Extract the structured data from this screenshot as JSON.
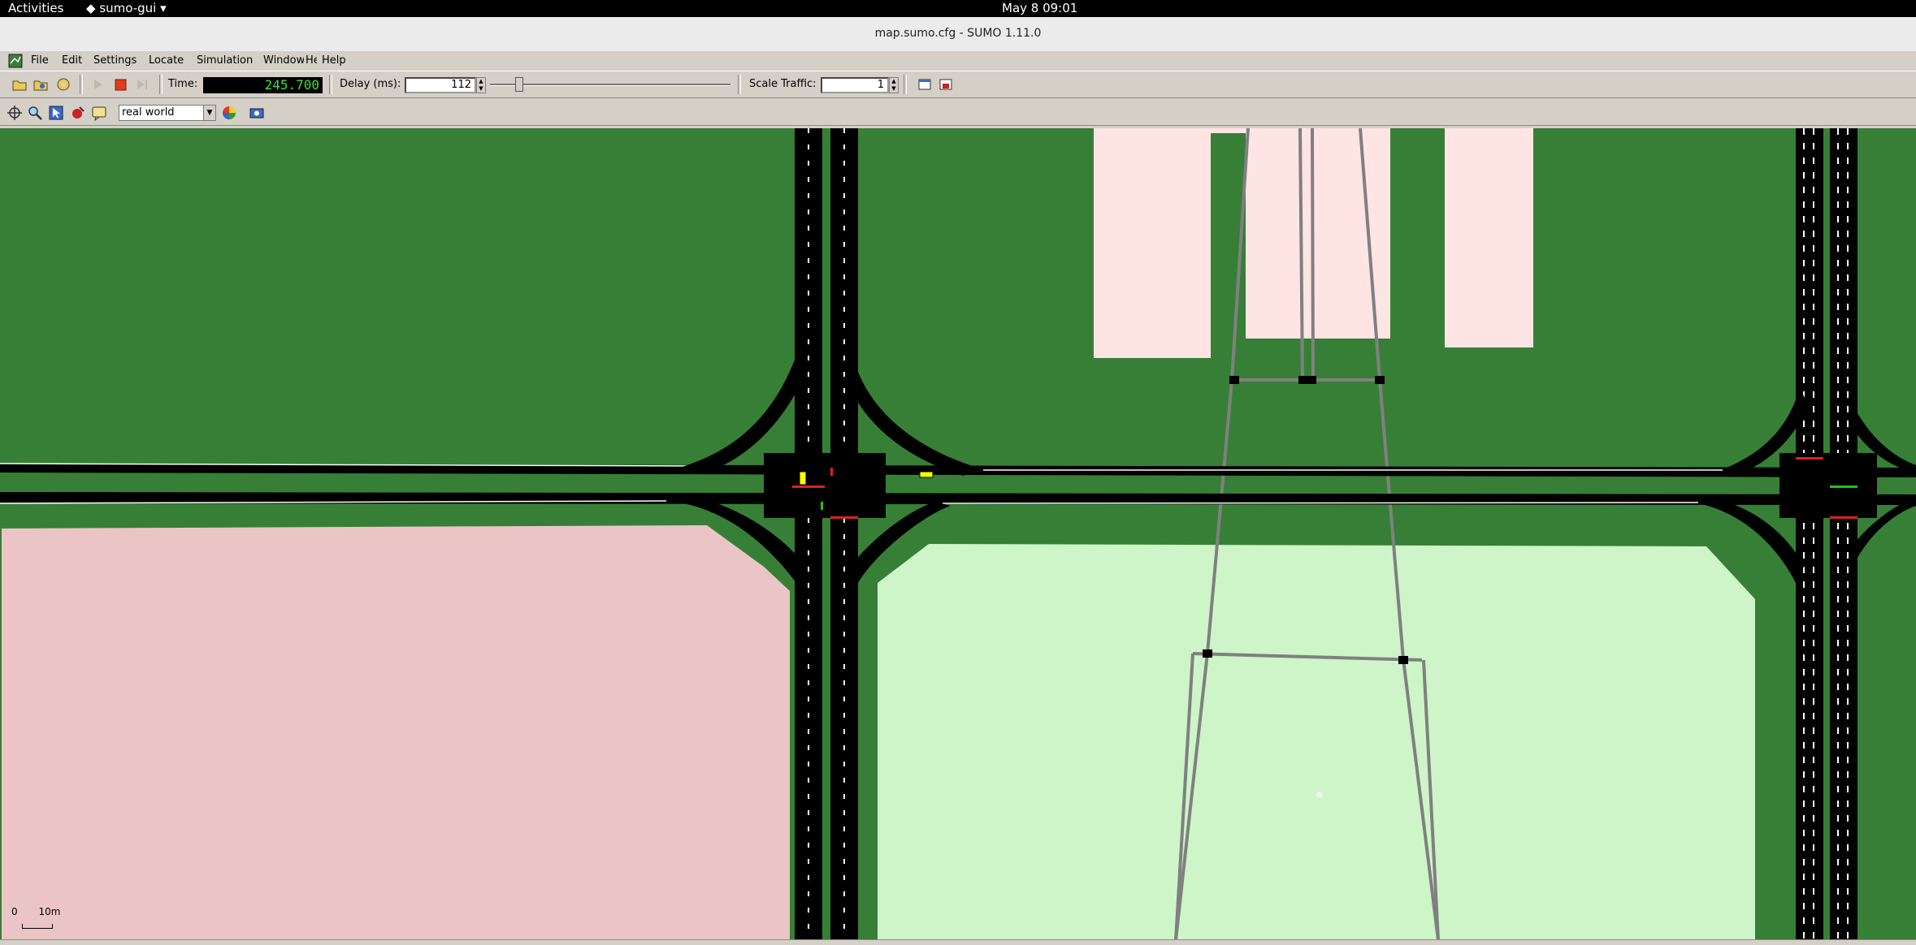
{
  "topbar": {
    "activities": "Activities",
    "app_menu": "sumo-gui",
    "clock": "May 8  09:01"
  },
  "window": {
    "title": "map.sumo.cfg - SUMO 1.11.0"
  },
  "menu": {
    "items": [
      "File",
      "Edit",
      "Settings",
      "Locate",
      "Simulation",
      "Windows",
      "Help"
    ]
  },
  "toolbar": {
    "time_label": "Time:",
    "time_value": "245.700",
    "delay_label": "Delay (ms):",
    "delay_value": "112",
    "delay_slider_fraction": 0.1,
    "scale_label": "Scale Traffic:",
    "scale_value": "1"
  },
  "view": {
    "scheme": "real world"
  },
  "scale_legend": {
    "zero": "0",
    "ten": "10m"
  },
  "colors": {
    "grass": "#377f36",
    "road": "#000000",
    "industrial": "#ebc5c6",
    "building": "#ffe4e4",
    "park": "#cdf5c8",
    "rail": "#808080",
    "vehicle": "#ffff00"
  }
}
